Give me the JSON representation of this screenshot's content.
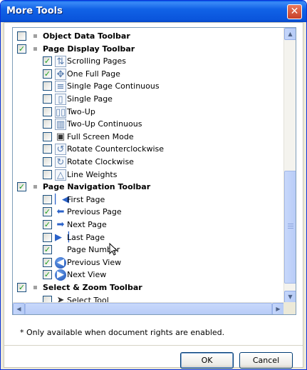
{
  "window": {
    "title": "More Tools",
    "close_glyph": "✕"
  },
  "list": {
    "rows": [
      {
        "type": "section",
        "label": "Object Data Toolbar",
        "checked": false
      },
      {
        "type": "section",
        "label": "Page Display Toolbar",
        "checked": true
      },
      {
        "type": "item",
        "label": "Scrolling Pages",
        "checked": true,
        "icon": "scrolling-pages-icon",
        "glyph": "⇅"
      },
      {
        "type": "item",
        "label": "One Full Page",
        "checked": true,
        "icon": "one-full-page-icon",
        "glyph": "✥"
      },
      {
        "type": "item",
        "label": "Single Page Continuous",
        "checked": false,
        "icon": "single-page-continuous-icon",
        "glyph": "≡"
      },
      {
        "type": "item",
        "label": "Single Page",
        "checked": false,
        "icon": "single-page-icon",
        "glyph": "▯"
      },
      {
        "type": "item",
        "label": "Two-Up",
        "checked": false,
        "icon": "two-up-icon",
        "glyph": "▯▯"
      },
      {
        "type": "item",
        "label": "Two-Up Continuous",
        "checked": false,
        "icon": "two-up-continuous-icon",
        "glyph": "▥"
      },
      {
        "type": "item",
        "label": "Full Screen Mode",
        "checked": false,
        "icon": "full-screen-mode-icon",
        "glyph": "▣"
      },
      {
        "type": "item",
        "label": "Rotate Counterclockwise",
        "checked": false,
        "icon": "rotate-counterclockwise-icon",
        "glyph": "↺"
      },
      {
        "type": "item",
        "label": "Rotate Clockwise",
        "checked": false,
        "icon": "rotate-clockwise-icon",
        "glyph": "↻"
      },
      {
        "type": "item",
        "label": "Line Weights",
        "checked": false,
        "icon": "line-weights-icon",
        "glyph": "△"
      },
      {
        "type": "section",
        "label": "Page Navigation Toolbar",
        "checked": true
      },
      {
        "type": "item",
        "label": "First Page",
        "checked": false,
        "icon": "first-page-icon",
        "glyph": "▏◀"
      },
      {
        "type": "item",
        "label": "Previous Page",
        "checked": true,
        "icon": "previous-page-icon",
        "glyph": "⬅"
      },
      {
        "type": "item",
        "label": "Next Page",
        "checked": true,
        "icon": "next-page-icon",
        "glyph": "➡"
      },
      {
        "type": "item",
        "label": "Last Page",
        "checked": false,
        "icon": "last-page-icon",
        "glyph": "▶▕"
      },
      {
        "type": "item",
        "label": "Page Number",
        "checked": true,
        "icon": "none",
        "glyph": ""
      },
      {
        "type": "item",
        "label": "Previous View",
        "checked": true,
        "icon": "previous-view-icon",
        "glyph": "◀"
      },
      {
        "type": "item",
        "label": "Next View",
        "checked": true,
        "icon": "next-view-icon",
        "glyph": "▶"
      },
      {
        "type": "section",
        "label": "Select & Zoom Toolbar",
        "checked": true
      },
      {
        "type": "item",
        "label": "Select Tool",
        "checked": false,
        "icon": "select-tool-icon",
        "glyph": "➤"
      }
    ],
    "check_glyph": "✓"
  },
  "scrollbar": {
    "up": "▲",
    "down": "▼",
    "left": "◀",
    "right": "▶"
  },
  "footer": {
    "note": "* Only available when document rights are enabled.",
    "ok_label": "OK",
    "cancel_label": "Cancel"
  }
}
